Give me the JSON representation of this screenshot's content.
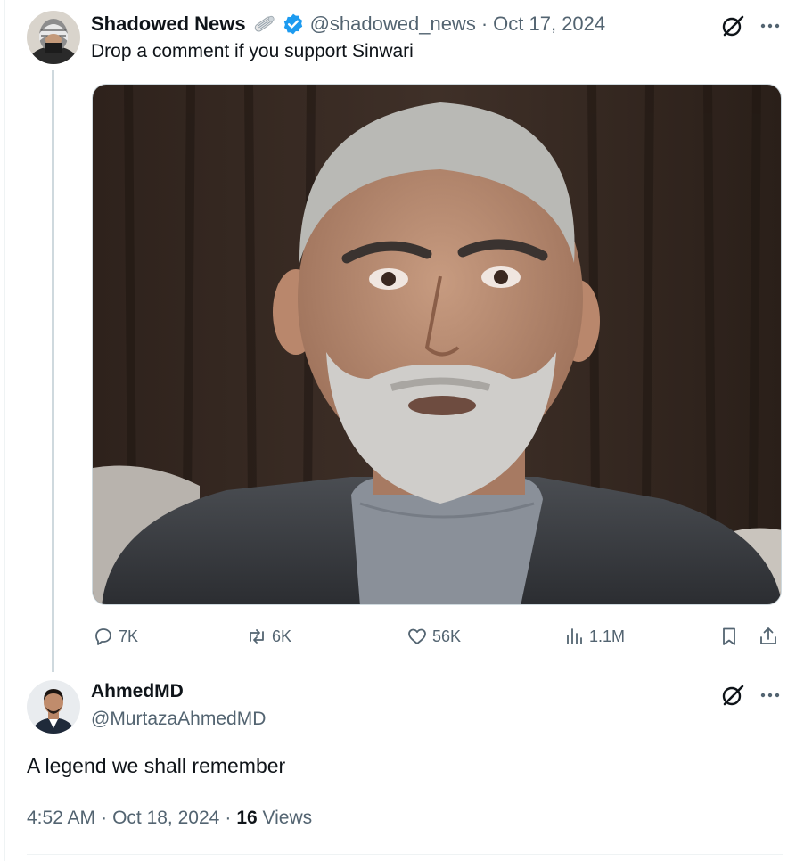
{
  "original_tweet": {
    "author_name": "Shadowed News",
    "name_emoji_icon": "newspaper-roll-icon",
    "verified_icon": "verified-badge-icon",
    "handle": "@shadowed_news",
    "separator": "·",
    "date": "Oct 17, 2024",
    "text": "Drop a comment if you support Sinwari",
    "media_icon": "photo-of-man-icon",
    "actions": {
      "replies": "7K",
      "reposts": "6K",
      "likes": "56K",
      "views": "1.1M"
    }
  },
  "reply_tweet": {
    "author_name": "AhmedMD",
    "handle": "@MurtazaAhmedMD",
    "text": "A legend we shall remember",
    "time": "4:52 AM",
    "separator": "·",
    "date": "Oct 18, 2024",
    "separator2": "·",
    "views_count": "16",
    "views_label": "Views"
  },
  "colors": {
    "accent": "#1d9bf0",
    "text_primary": "#0f1419",
    "text_secondary": "#536471",
    "thread_line": "#cfd9de"
  }
}
